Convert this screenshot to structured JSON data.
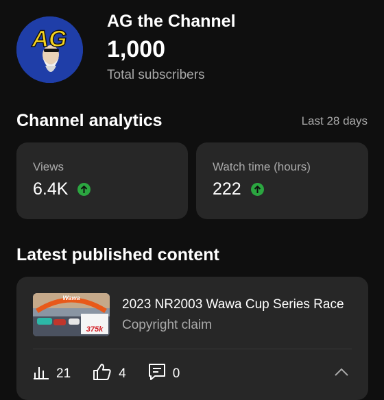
{
  "channel": {
    "name": "AG the Channel",
    "subscriber_count": "1,000",
    "subscriber_label": "Total subscribers",
    "avatar_initials": "AG"
  },
  "analytics": {
    "title": "Channel analytics",
    "period": "Last 28 days",
    "metrics": [
      {
        "label": "Views",
        "value": "6.4K",
        "trend": "up"
      },
      {
        "label": "Watch time (hours)",
        "value": "222",
        "trend": "up"
      }
    ]
  },
  "latest": {
    "title": "Latest published content",
    "video": {
      "title": "2023 NR2003 Wawa Cup Series Race",
      "subtitle": "Copyright claim",
      "thumbnail_text": {
        "banner": "Wawa",
        "logo": "375k"
      },
      "stats": {
        "views": "21",
        "likes": "4",
        "comments": "0"
      }
    }
  },
  "colors": {
    "background": "#0f0f0f",
    "card": "#272727",
    "trend_up": "#2ba640",
    "secondary_text": "#aaaaaa"
  }
}
